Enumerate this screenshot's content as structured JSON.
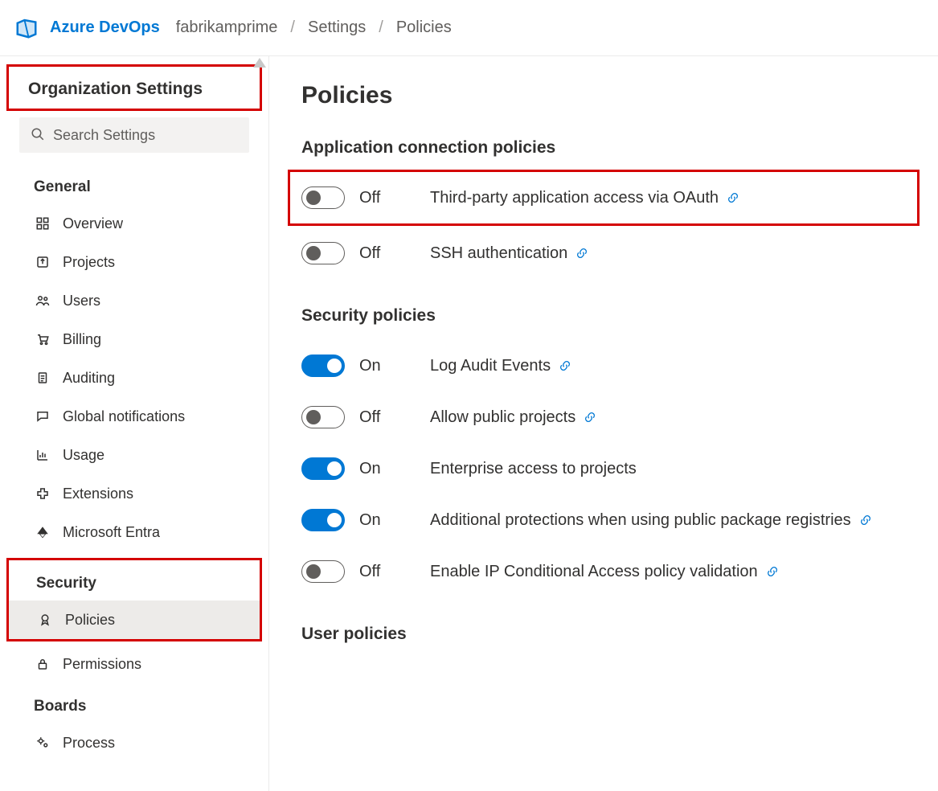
{
  "topbar": {
    "product": "Azure DevOps",
    "crumbs": [
      "fabrikamprime",
      "Settings",
      "Policies"
    ]
  },
  "sidebar": {
    "title": "Organization Settings",
    "search_placeholder": "Search Settings",
    "groups": {
      "general": {
        "label": "General",
        "items": [
          {
            "icon": "dashboard",
            "label": "Overview"
          },
          {
            "icon": "export",
            "label": "Projects"
          },
          {
            "icon": "users",
            "label": "Users"
          },
          {
            "icon": "cart",
            "label": "Billing"
          },
          {
            "icon": "clipboard",
            "label": "Auditing"
          },
          {
            "icon": "chat",
            "label": "Global notifications"
          },
          {
            "icon": "chart",
            "label": "Usage"
          },
          {
            "icon": "puzzle",
            "label": "Extensions"
          },
          {
            "icon": "entra",
            "label": "Microsoft Entra"
          }
        ]
      },
      "security": {
        "label": "Security",
        "items": [
          {
            "icon": "ribbon",
            "label": "Policies",
            "selected": true
          },
          {
            "icon": "lock",
            "label": "Permissions"
          }
        ]
      },
      "boards": {
        "label": "Boards",
        "items": [
          {
            "icon": "gears",
            "label": "Process"
          }
        ]
      }
    }
  },
  "main": {
    "title": "Policies",
    "sections": {
      "app_conn": {
        "title": "Application connection policies",
        "policies": [
          {
            "on": false,
            "state": "Off",
            "label": "Third-party application access via OAuth",
            "has_link": true,
            "highlighted": true
          },
          {
            "on": false,
            "state": "Off",
            "label": "SSH authentication",
            "has_link": true
          }
        ]
      },
      "security": {
        "title": "Security policies",
        "policies": [
          {
            "on": true,
            "state": "On",
            "label": "Log Audit Events",
            "has_link": true
          },
          {
            "on": false,
            "state": "Off",
            "label": "Allow public projects",
            "has_link": true
          },
          {
            "on": true,
            "state": "On",
            "label": "Enterprise access to projects",
            "has_link": false
          },
          {
            "on": true,
            "state": "On",
            "label": "Additional protections when using public package registries",
            "has_link": true
          },
          {
            "on": false,
            "state": "Off",
            "label": "Enable IP Conditional Access policy validation",
            "has_link": true
          }
        ]
      },
      "user": {
        "title": "User policies"
      }
    }
  }
}
